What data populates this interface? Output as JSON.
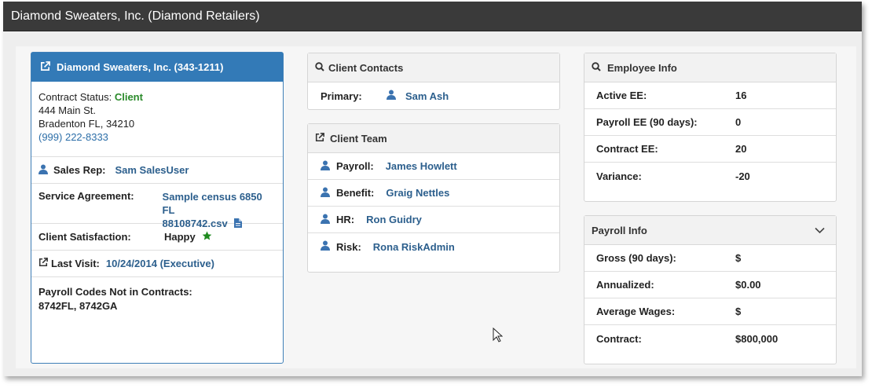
{
  "window": {
    "title": "Diamond Sweaters, Inc. (Diamond Retailers)"
  },
  "client": {
    "header": "Diamond Sweaters, Inc. (343-1211)",
    "status_label": "Contract Status:",
    "status_value": "Client",
    "address1": "444 Main St.",
    "address2": "Bradenton FL, 34210",
    "phone": "(999) 222-8333",
    "sales_rep_label": "Sales Rep:",
    "sales_rep": "Sam SalesUser",
    "service_agreement_label": "Service Agreement:",
    "service_agreement_line1": "Sample census 6850 FL",
    "service_agreement_line2": "88108742.csv",
    "satisfaction_label": "Client Satisfaction:",
    "satisfaction_value": "Happy",
    "last_visit_label": "Last Visit:",
    "last_visit_value": "10/24/2014 (Executive)",
    "payroll_codes_label": "Payroll Codes Not in Contracts:",
    "payroll_codes_value": "8742FL, 8742GA"
  },
  "contacts": {
    "header": "Client Contacts",
    "primary_label": "Primary:",
    "primary_value": "Sam Ash"
  },
  "team": {
    "header": "Client Team",
    "members": [
      {
        "role": "Payroll:",
        "name": "James Howlett"
      },
      {
        "role": "Benefit:",
        "name": "Graig Nettles"
      },
      {
        "role": "HR:",
        "name": "Ron Guidry"
      },
      {
        "role": "Risk:",
        "name": "Rona RiskAdmin"
      }
    ]
  },
  "employee": {
    "header": "Employee Info",
    "rows": [
      {
        "label": "Active EE:",
        "value": "16"
      },
      {
        "label": "Payroll EE (90 days):",
        "value": "0"
      },
      {
        "label": "Contract EE:",
        "value": "20"
      },
      {
        "label": "Variance:",
        "value": "-20"
      }
    ]
  },
  "payroll": {
    "header": "Payroll Info",
    "rows": [
      {
        "label": "Gross (90 days):",
        "value": "$"
      },
      {
        "label": "Annualized:",
        "value": "$0.00"
      },
      {
        "label": "Average Wages:",
        "value": "$"
      },
      {
        "label": "Contract:",
        "value": "$800,000"
      }
    ]
  },
  "colors": {
    "accent": "#337ab7",
    "link": "#2c5f8d",
    "status_green": "#2a8a2a",
    "star_green": "#1e8a1e"
  }
}
